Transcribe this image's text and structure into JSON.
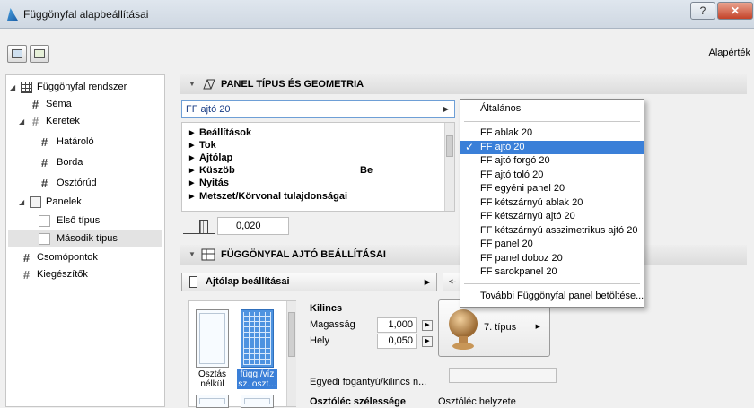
{
  "window": {
    "title": "Függönyfal alapbeállításai"
  },
  "toolbar": {
    "defaults_label": "Alapérték"
  },
  "tree": [
    {
      "label": "Függönyfal rendszer",
      "icon": "curtain-wall-icon",
      "expanded": true
    },
    {
      "label": "Séma",
      "icon": "grid-icon"
    },
    {
      "label": "Keretek",
      "icon": "frame-icon",
      "expanded": true
    },
    {
      "label": "Határoló",
      "icon": "frame-icon"
    },
    {
      "label": "Borda",
      "icon": "frame-icon"
    },
    {
      "label": "Osztórúd",
      "icon": "frame-icon"
    },
    {
      "label": "Panelek",
      "icon": "panel-icon",
      "expanded": true
    },
    {
      "label": "Első típus",
      "icon": "panel-icon"
    },
    {
      "label": "Második típus",
      "icon": "panel-icon",
      "selected": true
    },
    {
      "label": "Csomópontok",
      "icon": "junction-icon"
    },
    {
      "label": "Kiegészítők",
      "icon": "accessory-icon"
    }
  ],
  "panel_section": {
    "title": "PANEL TÍPUS ÉS GEOMETRIA",
    "selected_type": "FF ajtó 20",
    "properties": [
      {
        "label": "Beállítások",
        "value": ""
      },
      {
        "label": "Tok",
        "value": ""
      },
      {
        "label": "Ajtólap",
        "value": ""
      },
      {
        "label": "Küszöb",
        "value": "Be"
      },
      {
        "label": "Nyitás",
        "value": ""
      },
      {
        "label": "Metszet/Körvonal tulajdonságai",
        "value": ""
      }
    ],
    "thickness": "0,020"
  },
  "dropdown": {
    "header": "Általános",
    "items": [
      "FF ablak 20",
      "FF ajtó 20",
      "FF ajtó forgó 20",
      "FF ajtó toló 20",
      "FF egyéni panel 20",
      "FF kétszárnyú ablak 20",
      "FF kétszárnyú ajtó 20",
      "FF kétszárnyú asszimetrikus ajtó 20",
      "FF panel 20",
      "FF panel doboz 20",
      "FF sarokpanel 20"
    ],
    "selected_index": 1,
    "footer": "További Függönyfal panel betöltése..."
  },
  "door_section": {
    "title": "FÜGGÖNYFAL AJTÓ BEÁLLÍTÁSAI",
    "door_leaf_settings": "Ajtólap beállításai",
    "nav_prev": "<-",
    "thumbs": [
      {
        "label": "Osztás nélkül",
        "selected": false
      },
      {
        "label": "függ./víz sz. oszt...",
        "selected": true
      }
    ],
    "handle": {
      "heading": "Kilincs",
      "height_label": "Magasság",
      "height_value": "1,000",
      "position_label": "Hely",
      "position_value": "0,050",
      "type_label": "7. típus"
    },
    "custom_handle_label": "Egyedi fogantyú/kilincs n...",
    "mullion_width_label": "Osztóléc szélessége",
    "mullion_position_label": "Osztóléc helyzete"
  }
}
